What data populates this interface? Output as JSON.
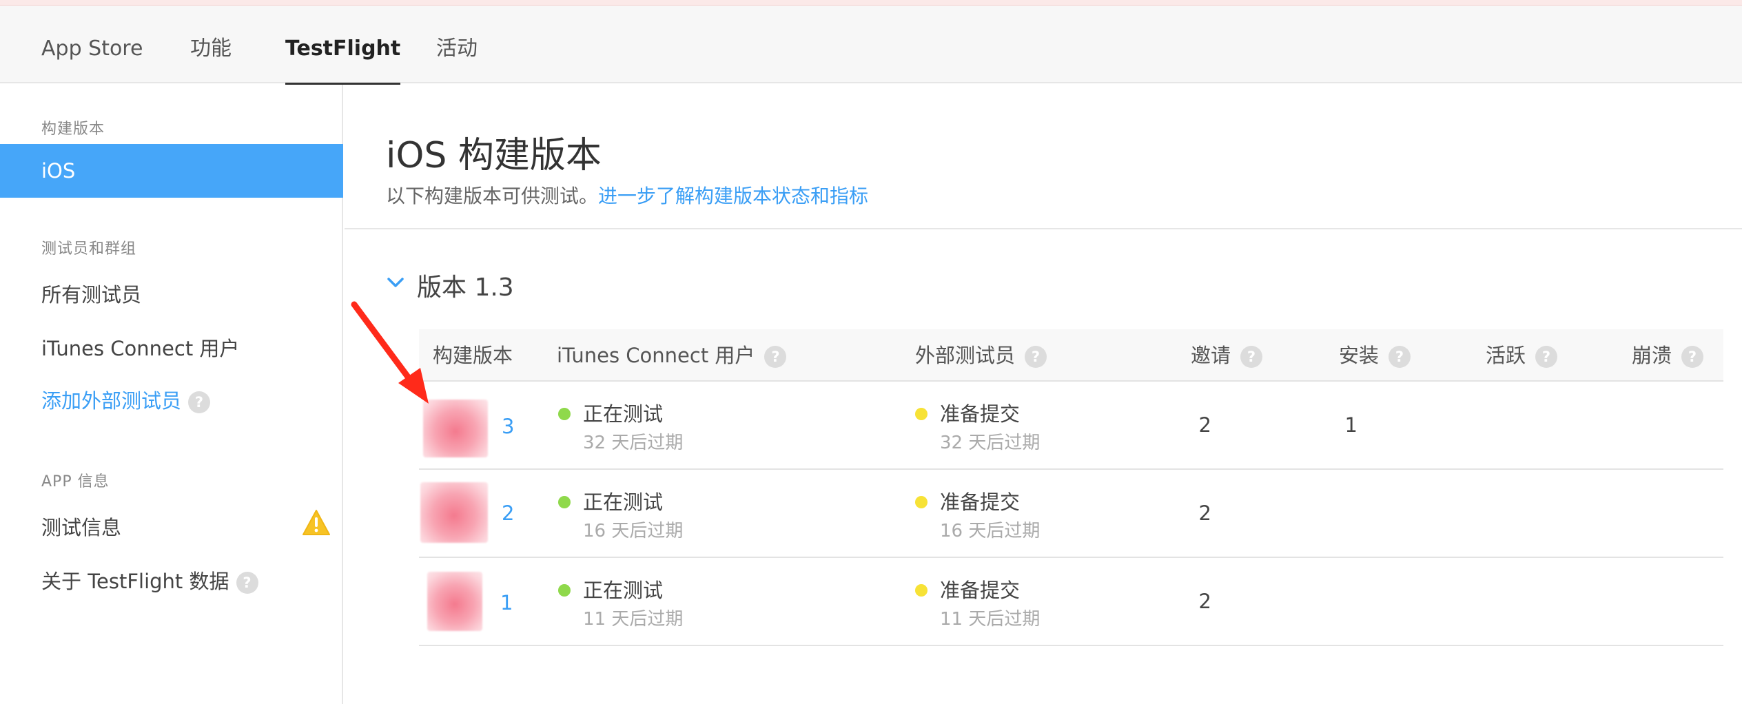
{
  "colors": {
    "accent": "#46a6f9",
    "link": "#3a9ef5",
    "status_green": "#8fd94b",
    "status_yellow": "#f7e236",
    "annotation_arrow": "#ff2a1a"
  },
  "topnav": {
    "tabs": [
      {
        "label": "App Store",
        "active": false
      },
      {
        "label": "功能",
        "active": false
      },
      {
        "label": "TestFlight",
        "active": true
      },
      {
        "label": "活动",
        "active": false
      }
    ]
  },
  "sidebar": {
    "sections": [
      {
        "title": "构建版本",
        "items": [
          {
            "label": "iOS",
            "selected": true
          }
        ]
      },
      {
        "title": "测试员和群组",
        "items": [
          {
            "label": "所有测试员"
          },
          {
            "label": "iTunes Connect 用户"
          },
          {
            "label": "添加外部测试员",
            "link": true,
            "help": "?"
          }
        ]
      },
      {
        "title": "APP 信息",
        "items": [
          {
            "label": "测试信息",
            "icon": "warning-icon"
          },
          {
            "label": "关于 TestFlight 数据",
            "help": "?"
          }
        ]
      }
    ]
  },
  "main": {
    "title": "iOS 构建版本",
    "subtitle_text": "以下构建版本可供测试。",
    "subtitle_link": "进一步了解构建版本状态和指标",
    "version_group": {
      "title": "版本 1.3",
      "chevron_icon": "chevron-down-icon",
      "columns": [
        {
          "label": "构建版本"
        },
        {
          "label": "iTunes Connect 用户",
          "help": "?"
        },
        {
          "label": "外部测试员",
          "help": "?"
        },
        {
          "label": "邀请",
          "help": "?"
        },
        {
          "label": "安装",
          "help": "?"
        },
        {
          "label": "活跃",
          "help": "?"
        },
        {
          "label": "崩溃",
          "help": "?"
        }
      ],
      "rows": [
        {
          "build": "3",
          "itc_status": "正在测试",
          "itc_expire": "32 天后过期",
          "ext_status": "准备提交",
          "ext_expire": "32 天后过期",
          "invites": "2",
          "installs": "1",
          "active": "",
          "crashes": ""
        },
        {
          "build": "2",
          "itc_status": "正在测试",
          "itc_expire": "16 天后过期",
          "ext_status": "准备提交",
          "ext_expire": "16 天后过期",
          "invites": "2",
          "installs": "",
          "active": "",
          "crashes": ""
        },
        {
          "build": "1",
          "itc_status": "正在测试",
          "itc_expire": "11 天后过期",
          "ext_status": "准备提交",
          "ext_expire": "11 天后过期",
          "invites": "2",
          "installs": "",
          "active": "",
          "crashes": ""
        }
      ]
    }
  }
}
